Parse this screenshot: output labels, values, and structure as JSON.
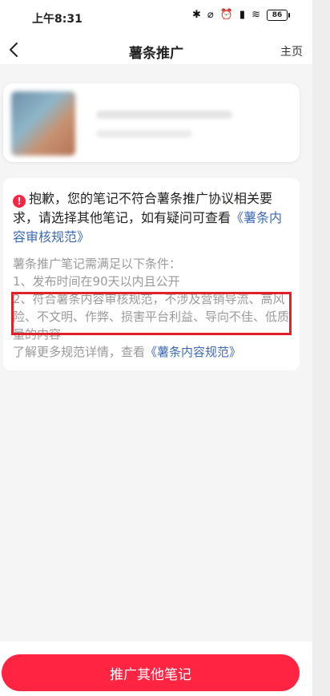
{
  "status_bar": {
    "time": "上午8:31",
    "battery": "86",
    "icons": [
      "bluetooth-icon",
      "mute-icon",
      "alarm-icon",
      "signal-icon",
      "wifi-icon",
      "battery-icon"
    ]
  },
  "nav": {
    "title": "薯条推广",
    "right_label": "主页"
  },
  "message": {
    "error_text": "抱歉，您的笔记不符合薯条推广协议相关要求，请选择其他笔记，如有疑问可查看",
    "error_link": "《薯条内容审核规范》",
    "conditions_title": "薯条推广笔记需满足以下条件：",
    "condition_1": "1、发布时间在90天以内且公开",
    "condition_2": "2、符合薯条内容审核规范，不涉及营销导流、高风险、不文明、作弊、损害平台利益、导向不佳、低质量的内容",
    "more_prefix": "了解更多规范详情，查看",
    "more_link": "《薯条内容规范》"
  },
  "bottom": {
    "button_label": "推广其他笔记"
  },
  "colors": {
    "accent": "#ff2442",
    "link": "#3e6bb3",
    "highlight": "#e0202a"
  }
}
